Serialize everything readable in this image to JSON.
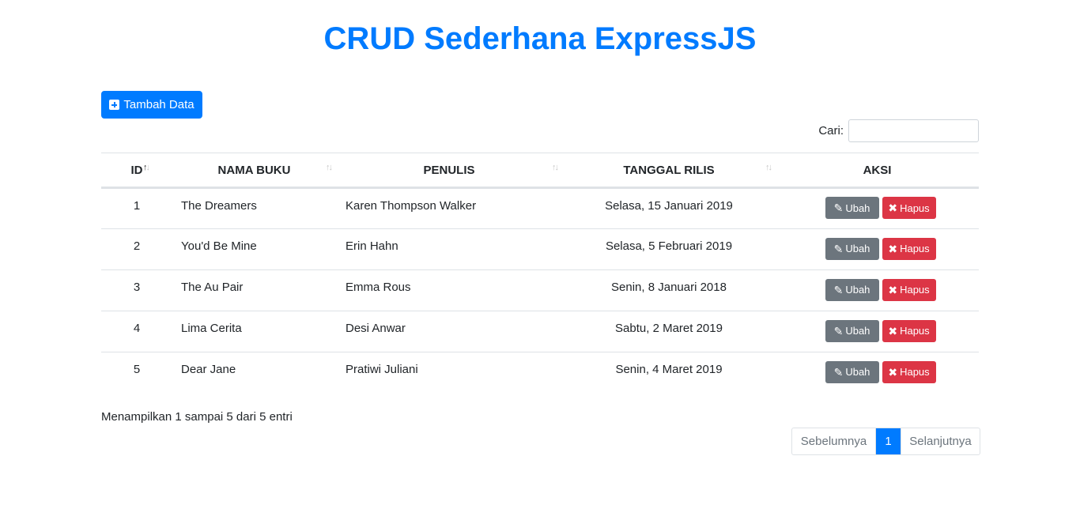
{
  "page": {
    "title": "CRUD Sederhana ExpressJS"
  },
  "toolbar": {
    "add_label": "Tambah Data",
    "add_icon": "plus-square-icon"
  },
  "search": {
    "label": "Cari:",
    "value": "",
    "placeholder": ""
  },
  "table": {
    "headers": [
      "ID",
      "NAMA BUKU",
      "PENULIS",
      "TANGGAL RILIS",
      "AKSI"
    ],
    "rows": [
      {
        "id": "1",
        "name": "The Dreamers",
        "author": "Karen Thompson Walker",
        "date": "Selasa, 15 Januari 2019"
      },
      {
        "id": "2",
        "name": "You'd Be Mine",
        "author": "Erin Hahn",
        "date": "Selasa, 5 Februari 2019"
      },
      {
        "id": "3",
        "name": "The Au Pair",
        "author": "Emma Rous",
        "date": "Senin, 8 Januari 2018"
      },
      {
        "id": "4",
        "name": "Lima Cerita",
        "author": "Desi Anwar",
        "date": "Sabtu, 2 Maret 2019"
      },
      {
        "id": "5",
        "name": "Dear Jane",
        "author": "Pratiwi Juliani",
        "date": "Senin, 4 Maret 2019"
      }
    ],
    "edit_label": "Ubah",
    "delete_label": "Hapus"
  },
  "footer": {
    "info": "Menampilkan 1 sampai 5 dari 5 entri",
    "prev": "Sebelumnya",
    "current": "1",
    "next": "Selanjutnya"
  },
  "colors": {
    "primary": "#007bff",
    "secondary": "#6c757d",
    "danger": "#dc3545"
  }
}
